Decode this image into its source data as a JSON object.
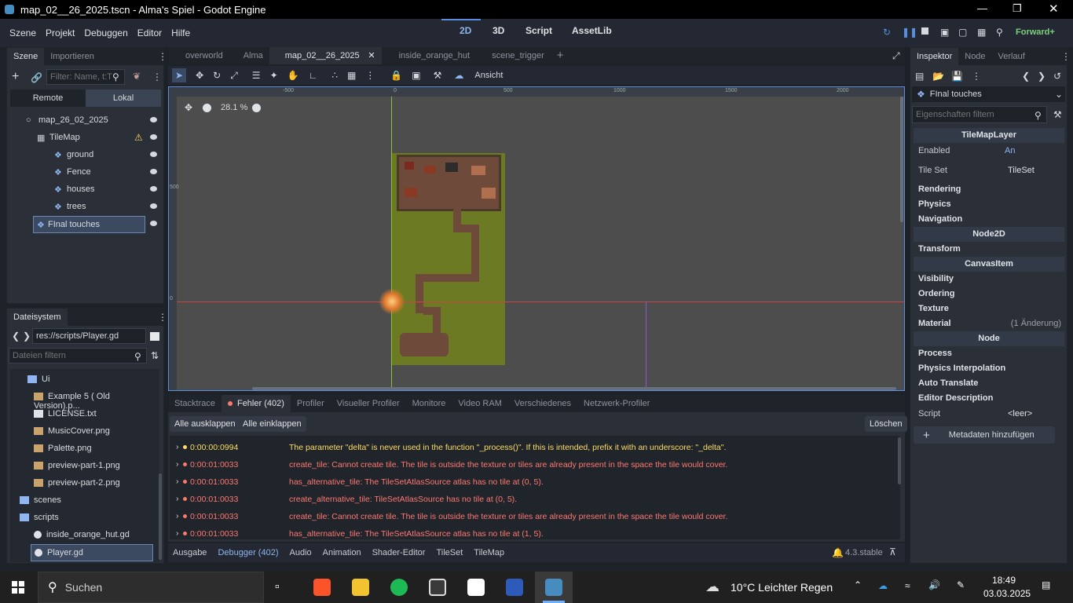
{
  "window": {
    "title": "map_02__26_2025.tscn - Alma's Spiel - Godot Engine"
  },
  "menu": [
    "Szene",
    "Projekt",
    "Debuggen",
    "Editor",
    "Hilfe"
  ],
  "workspaces": [
    "2D",
    "3D",
    "Script",
    "AssetLib"
  ],
  "renderer": "Forward+",
  "scene_panel": {
    "tabs": [
      "Szene",
      "Importieren"
    ],
    "filter_placeholder": "Filter: Name, t:T",
    "remote": "Remote",
    "local": "Lokal",
    "nodes": [
      {
        "name": "map_26_02_2025",
        "depth": 0
      },
      {
        "name": "TileMap",
        "depth": 1
      },
      {
        "name": "ground",
        "depth": 2
      },
      {
        "name": "Fence",
        "depth": 2
      },
      {
        "name": "houses",
        "depth": 2
      },
      {
        "name": "trees",
        "depth": 2
      },
      {
        "name": "FInal touches",
        "depth": 2
      }
    ]
  },
  "filesystem": {
    "title": "Dateisystem",
    "path": "res://scripts/Player.gd",
    "filter_placeholder": "Dateien filtern",
    "items": [
      {
        "name": "Ui",
        "type": "folder"
      },
      {
        "name": "Example 5 ( Old Version).p...",
        "type": "image"
      },
      {
        "name": "LICENSE.txt",
        "type": "text"
      },
      {
        "name": "MusicCover.png",
        "type": "image"
      },
      {
        "name": "Palette.png",
        "type": "image"
      },
      {
        "name": "preview-part-1.png",
        "type": "image"
      },
      {
        "name": "preview-part-2.png",
        "type": "image"
      },
      {
        "name": "scenes",
        "type": "folder"
      },
      {
        "name": "scripts",
        "type": "folder"
      },
      {
        "name": "inside_orange_hut.gd",
        "type": "script"
      },
      {
        "name": "Player.gd",
        "type": "script"
      }
    ]
  },
  "scene_tabs": [
    "overworld",
    "Alma",
    "map_02__26_2025",
    "inside_orange_hut",
    "scene_trigger"
  ],
  "toolbar": {
    "view": "Ansicht"
  },
  "viewport": {
    "zoom": "28.1 %",
    "ruler": [
      "-500",
      "0",
      "500",
      "1000",
      "1500",
      "2000"
    ],
    "ruler_v": [
      "500",
      "0"
    ]
  },
  "debugger": {
    "tabs": [
      "Stacktrace",
      "Fehler (402)",
      "Profiler",
      "Visueller Profiler",
      "Monitore",
      "Video RAM",
      "Verschiedenes",
      "Netzwerk-Profiler"
    ],
    "expand_all": "Alle ausklappen",
    "collapse_all": "Alle einklappen",
    "clear": "Löschen",
    "errors": [
      {
        "time": "0:00:00:0994",
        "msg": "The parameter \"delta\" is never used in the function \"_process()\". If this is intended, prefix it with an underscore: \"_delta\".",
        "level": "warning"
      },
      {
        "time": "0:00:01:0033",
        "msg": "create_tile: Cannot create tile. The tile is outside the texture or tiles are already present in the space the tile would cover.",
        "level": "error"
      },
      {
        "time": "0:00:01:0033",
        "msg": "has_alternative_tile: The TileSetAtlasSource atlas has no tile at (0, 5).",
        "level": "error"
      },
      {
        "time": "0:00:01:0033",
        "msg": "create_alternative_tile: TileSetAtlasSource has no tile at (0, 5).",
        "level": "error"
      },
      {
        "time": "0:00:01:0033",
        "msg": "create_tile: Cannot create tile. The tile is outside the texture or tiles are already present in the space the tile would cover.",
        "level": "error"
      },
      {
        "time": "0:00:01:0033",
        "msg": "has_alternative_tile: The TileSetAtlasSource atlas has no tile at (1, 5).",
        "level": "error"
      }
    ]
  },
  "bottom_tabs": [
    "Ausgabe",
    "Debugger (402)",
    "Audio",
    "Animation",
    "Shader-Editor",
    "TileSet",
    "TileMap"
  ],
  "version": "4.3.stable",
  "inspector": {
    "tabs": [
      "Inspektor",
      "Node",
      "Verlauf"
    ],
    "object": "FInal touches",
    "filter_placeholder": "Eigenschaften filtern",
    "sections": [
      {
        "kind": "header",
        "label": "TileMapLayer"
      },
      {
        "kind": "prop",
        "label": "Enabled",
        "value": "An"
      },
      {
        "kind": "prop",
        "label": "Tile Set",
        "value": "TileSet"
      },
      {
        "kind": "group",
        "label": "Rendering"
      },
      {
        "kind": "group",
        "label": "Physics"
      },
      {
        "kind": "group",
        "label": "Navigation"
      },
      {
        "kind": "header",
        "label": "Node2D"
      },
      {
        "kind": "group",
        "label": "Transform"
      },
      {
        "kind": "header",
        "label": "CanvasItem"
      },
      {
        "kind": "group",
        "label": "Visibility"
      },
      {
        "kind": "group",
        "label": "Ordering"
      },
      {
        "kind": "group",
        "label": "Texture"
      },
      {
        "kind": "group",
        "label": "Material",
        "note": "(1 Änderung)"
      },
      {
        "kind": "header",
        "label": "Node"
      },
      {
        "kind": "group",
        "label": "Process"
      },
      {
        "kind": "group",
        "label": "Physics Interpolation"
      },
      {
        "kind": "group",
        "label": "Auto Translate"
      },
      {
        "kind": "group",
        "label": "Editor Description"
      },
      {
        "kind": "prop",
        "label": "Script",
        "value": "<leer>"
      }
    ],
    "add_metadata": "Metadaten hinzufügen"
  },
  "taskbar": {
    "search": "Suchen",
    "weather": "10°C  Leichter Regen",
    "time": "18:49",
    "date": "03.03.2025"
  },
  "colors": {
    "accent": "#5a8de1",
    "error": "#ff7870",
    "warning": "#ffdd65"
  }
}
